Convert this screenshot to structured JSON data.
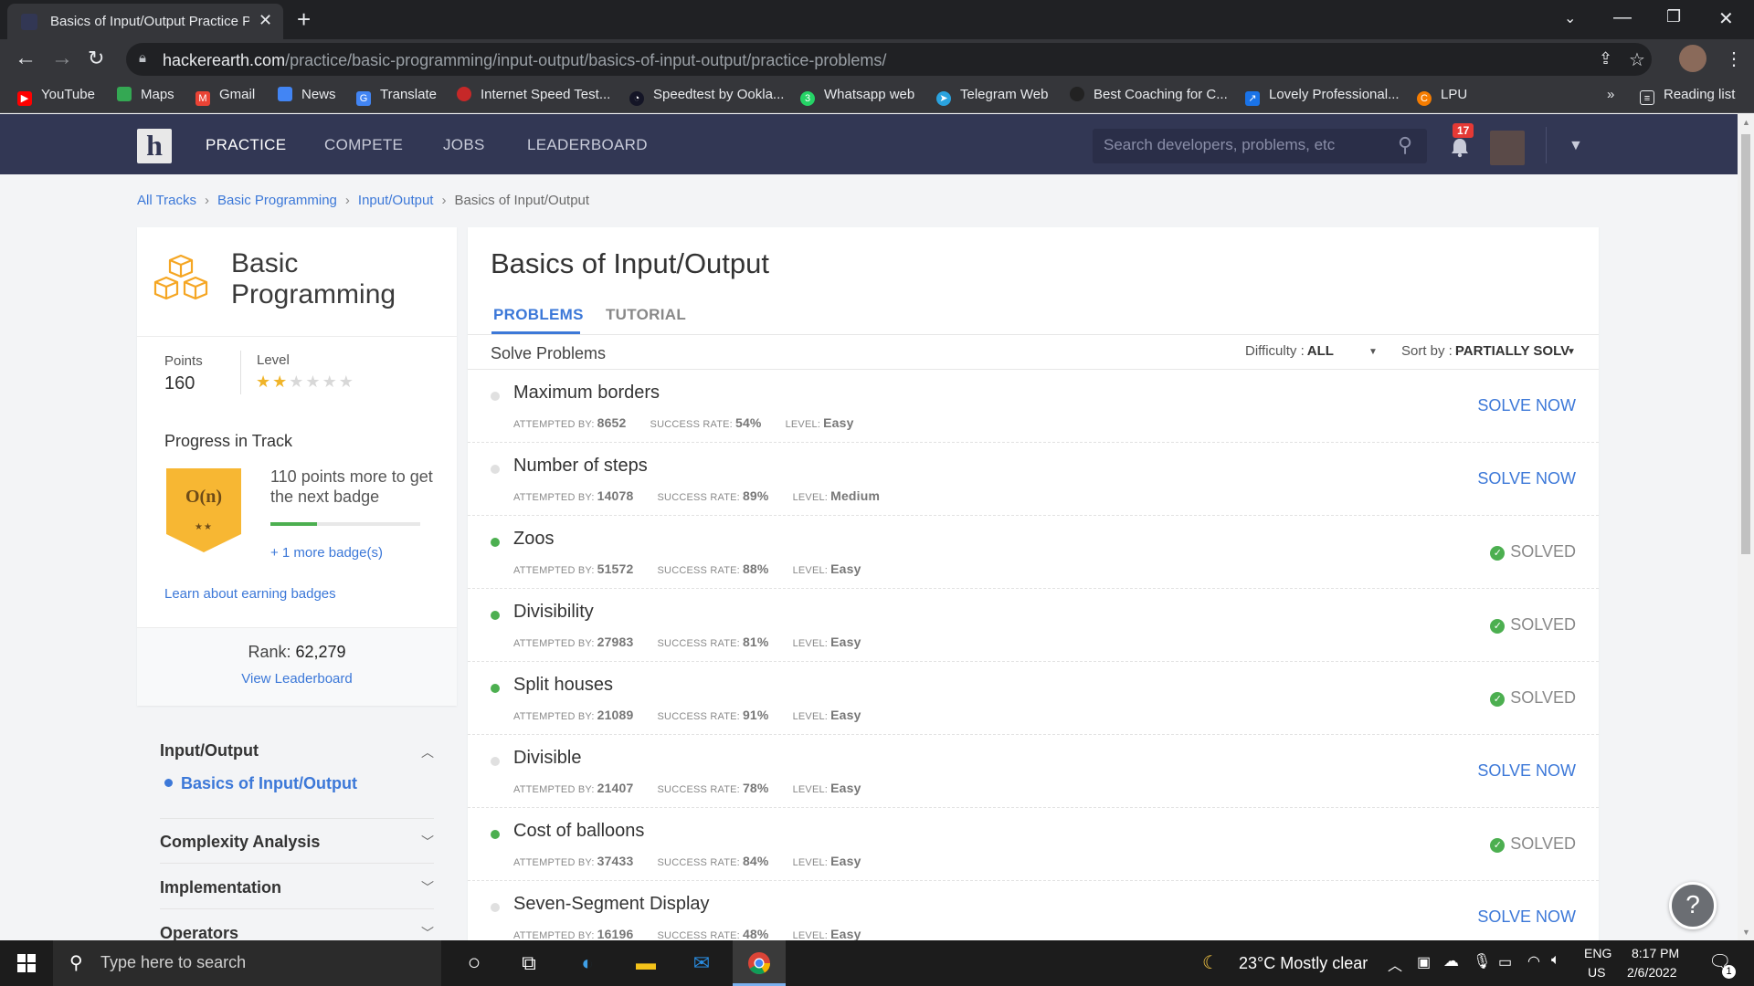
{
  "browser": {
    "tab_title": "Basics of Input/Output Practice P",
    "url_host": "hackerearth.com",
    "url_path": "/practice/basic-programming/input-output/basics-of-input-output/practice-problems/",
    "bookmarks": [
      {
        "label": "YouTube",
        "icon": "youtube-icon",
        "color": "#ff0000"
      },
      {
        "label": "Maps",
        "icon": "maps-icon",
        "color": "#34a853"
      },
      {
        "label": "Gmail",
        "icon": "gmail-icon",
        "color": "#ea4335"
      },
      {
        "label": "News",
        "icon": "news-icon",
        "color": "#4285f4"
      },
      {
        "label": "Translate",
        "icon": "translate-icon",
        "color": "#4285f4"
      },
      {
        "label": "Internet Speed Test...",
        "icon": "speedtest-icon",
        "color": "#c62828"
      },
      {
        "label": "Speedtest by Ookla...",
        "icon": "ookla-icon",
        "color": "#141526"
      },
      {
        "label": "Whatsapp web",
        "icon": "whatsapp-icon",
        "color": "#25d366"
      },
      {
        "label": "Telegram Web",
        "icon": "telegram-icon",
        "color": "#2aa3df"
      },
      {
        "label": "Best Coaching for C...",
        "icon": "coaching-icon",
        "color": "#222222"
      },
      {
        "label": "Lovely Professional...",
        "icon": "lpu-link-icon",
        "color": "#1a73e8"
      },
      {
        "label": "LPU",
        "icon": "lpu-icon",
        "color": "#f57c00"
      }
    ],
    "reading_list": "Reading list",
    "overflow": "»"
  },
  "header": {
    "logo": "h",
    "nav": [
      "PRACTICE",
      "COMPETE",
      "JOBS",
      "LEADERBOARD"
    ],
    "search_placeholder": "Search developers, problems, etc",
    "notifications": "17"
  },
  "breadcrumb": [
    "All Tracks",
    "Basic Programming",
    "Input/Output",
    "Basics of Input/Output"
  ],
  "sidebar": {
    "track_title": "Basic Programming",
    "points_label": "Points",
    "points": "160",
    "level_label": "Level",
    "level_stars": 2,
    "level_max": 6,
    "progress_title": "Progress in Track",
    "badge_text": "O(n)",
    "badge_stars": "★★",
    "badge_message": "110 points more to get the next badge",
    "badge_progress": 0.31,
    "more_badges": "+ 1 more badge(s)",
    "learn_badges": "Learn about earning badges",
    "rank_label": "Rank: ",
    "rank": "62,279",
    "view_leaderboard": "View Leaderboard",
    "topics": [
      {
        "label": "Input/Output",
        "expanded": true,
        "children": [
          "Basics of Input/Output"
        ]
      },
      {
        "label": "Complexity Analysis",
        "expanded": false
      },
      {
        "label": "Implementation",
        "expanded": false
      },
      {
        "label": "Operators",
        "expanded": false
      }
    ]
  },
  "main": {
    "title": "Basics of Input/Output",
    "tabs": [
      "PROBLEMS",
      "TUTORIAL"
    ],
    "solve_label": "Solve Problems",
    "difficulty_label": "Difficulty :",
    "difficulty_value": "ALL",
    "sort_label": "Sort by :",
    "sort_value": "PARTIALLY SOLVED",
    "meta_labels": {
      "attempted": "ATTEMPTED BY:",
      "success": "SUCCESS RATE:",
      "level": "LEVEL:"
    },
    "problems": [
      {
        "name": "Maximum borders",
        "attempted": "8652",
        "success": "54%",
        "level": "Easy",
        "status": "SOLVE NOW",
        "solved": false
      },
      {
        "name": "Number of steps",
        "attempted": "14078",
        "success": "89%",
        "level": "Medium",
        "status": "SOLVE NOW",
        "solved": false
      },
      {
        "name": "Zoos",
        "attempted": "51572",
        "success": "88%",
        "level": "Easy",
        "status": "SOLVED",
        "solved": true
      },
      {
        "name": "Divisibility",
        "attempted": "27983",
        "success": "81%",
        "level": "Easy",
        "status": "SOLVED",
        "solved": true
      },
      {
        "name": "Split houses",
        "attempted": "21089",
        "success": "91%",
        "level": "Easy",
        "status": "SOLVED",
        "solved": true
      },
      {
        "name": "Divisible",
        "attempted": "21407",
        "success": "78%",
        "level": "Easy",
        "status": "SOLVE NOW",
        "solved": false
      },
      {
        "name": "Cost of balloons",
        "attempted": "37433",
        "success": "84%",
        "level": "Easy",
        "status": "SOLVED",
        "solved": true
      },
      {
        "name": "Seven-Segment Display",
        "attempted": "16196",
        "success": "48%",
        "level": "Easy",
        "status": "SOLVE NOW",
        "solved": false
      }
    ],
    "help": "?"
  },
  "taskbar": {
    "search_placeholder": "Type here to search",
    "weather": "23°C  Mostly clear",
    "lang_top": "ENG",
    "lang_bottom": "US",
    "time": "8:17 PM",
    "date": "2/6/2022",
    "notif_count": "1"
  }
}
